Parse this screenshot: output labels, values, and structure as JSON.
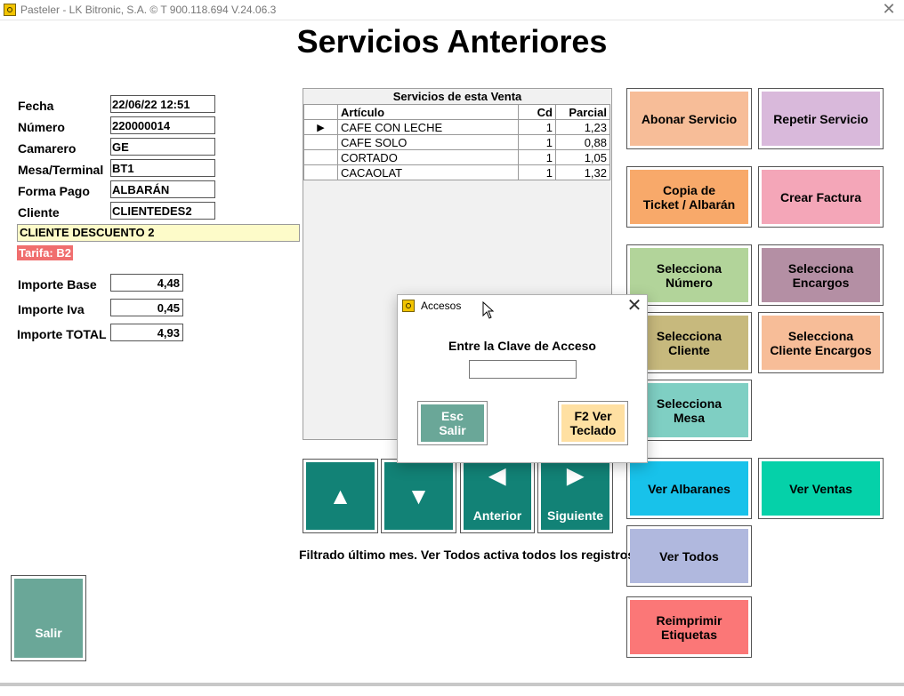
{
  "window": {
    "title": "Pasteler - LK Bitronic, S.A. ©  T 900.118.694 V.24.06.3",
    "close_glyph": "✕"
  },
  "page_title": "Servicios Anteriores",
  "form": {
    "fecha_label": "Fecha",
    "fecha_value": "22/06/22 12:51",
    "numero_label": "Número",
    "numero_value": "220000014",
    "camarero_label": "Camarero",
    "camarero_value": "GE",
    "mesa_label": "Mesa/Terminal",
    "mesa_value": "BT1",
    "formapago_label": "Forma Pago",
    "formapago_value": "ALBARÁN",
    "cliente_label": "Cliente",
    "cliente_value": "CLIENTEDES2",
    "cliente_nombre": "CLIENTE DESCUENTO 2",
    "tarifa": "Tarifa: B2",
    "base_label": "Importe Base",
    "base_value": "4,48",
    "iva_label": "Importe Iva",
    "iva_value": "0,45",
    "total_label": "Importe TOTAL",
    "total_value": "4,93"
  },
  "grid": {
    "caption": "Servicios de esta Venta",
    "headers": {
      "articulo": "Artículo",
      "cd": "Cd",
      "parcial": "Parcial"
    },
    "current_row_marker": "▶",
    "rows": [
      {
        "articulo": "CAFE CON LECHE",
        "cd": "1",
        "parcial": "1,23"
      },
      {
        "articulo": "CAFE SOLO",
        "cd": "1",
        "parcial": "0,88"
      },
      {
        "articulo": "CORTADO",
        "cd": "1",
        "parcial": "1,05"
      },
      {
        "articulo": "CACAOLAT",
        "cd": "1",
        "parcial": "1,32"
      }
    ]
  },
  "nav": {
    "up_glyph": "▲",
    "down_glyph": "▼",
    "prev_glyph": "◀",
    "next_glyph": "▶",
    "prev_label": "Anterior",
    "next_label": "Siguiente"
  },
  "filter_note": "Filtrado último mes. Ver Todos activa todos los registros",
  "buttons": {
    "abonar": "Abonar Servicio",
    "repetir": "Repetir Servicio",
    "copia_1": "Copia de",
    "copia_2": "Ticket / Albarán",
    "crear_factura": "Crear Factura",
    "sel_numero_1": "Selecciona",
    "sel_numero_2": "Número",
    "sel_encargos_1": "Selecciona",
    "sel_encargos_2": "Encargos",
    "sel_cliente_1": "Selecciona",
    "sel_cliente_2": "Cliente",
    "sel_cliente_enc_1": "Selecciona",
    "sel_cliente_enc_2": "Cliente Encargos",
    "sel_mesa_1": "Selecciona",
    "sel_mesa_2": "Mesa",
    "ver_albaranes": "Ver Albaranes",
    "ver_ventas": "Ver Ventas",
    "ver_todos": "Ver Todos",
    "reimprimir_1": "Reimprimir",
    "reimprimir_2": "Etiquetas",
    "salir": "Salir"
  },
  "dialog": {
    "title": "Accesos",
    "close_glyph": "✕",
    "prompt": "Entre la Clave de Acceso",
    "input_value": "",
    "esc_1": "Esc",
    "esc_2": "Salir",
    "f2_1": "F2 Ver",
    "f2_2": "Teclado"
  },
  "colors": {
    "abonar": "#f7bd98",
    "repetir": "#d9b9db",
    "copia": "#f8a96a",
    "crear_factura": "#f4a6b8",
    "sel_numero": "#b2d49a",
    "sel_encargos": "#b48fa4",
    "sel_cliente": "#c7b97d",
    "sel_cliente_enc": "#f7bd98",
    "sel_mesa": "#7fcfc3",
    "ver_albaranes": "#18c2ea",
    "ver_ventas": "#05d1a9",
    "ver_todos": "#b0b8de",
    "reimprimir": "#fb7777",
    "salir": "#6aa798",
    "teal": "#128276",
    "esc": "#6aa798",
    "f2": "#ffe0a2"
  }
}
